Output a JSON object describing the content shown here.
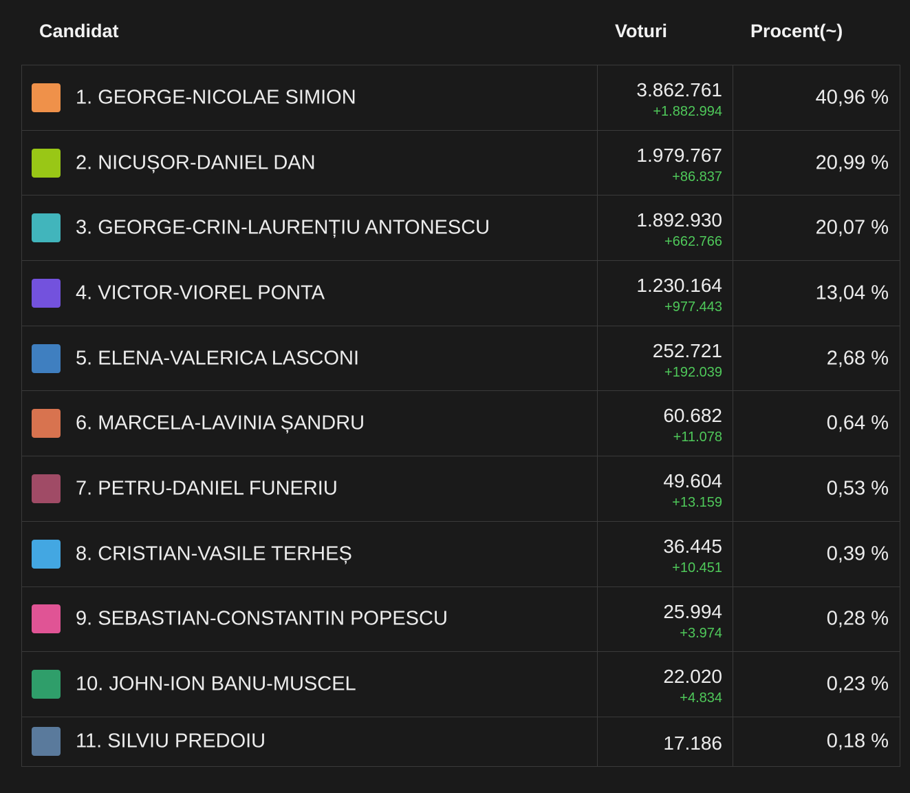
{
  "header": {
    "candidate": "Candidat",
    "votes": "Voturi",
    "percent": "Procent(~)"
  },
  "rows": [
    {
      "name": "1. GEORGE-NICOLAE SIMION",
      "votes": "3.862.761",
      "delta": "+1.882.994",
      "percent": "40,96 %",
      "color": "#ef914a"
    },
    {
      "name": "2. NICUȘOR-DANIEL DAN",
      "votes": "1.979.767",
      "delta": "+86.837",
      "percent": "20,99 %",
      "color": "#99c716"
    },
    {
      "name": "3. GEORGE-CRIN-LAURENȚIU ANTONESCU",
      "votes": "1.892.930",
      "delta": "+662.766",
      "percent": "20,07 %",
      "color": "#41b5bc"
    },
    {
      "name": "4. VICTOR-VIOREL PONTA",
      "votes": "1.230.164",
      "delta": "+977.443",
      "percent": "13,04 %",
      "color": "#7352dd"
    },
    {
      "name": "5. ELENA-VALERICA LASCONI",
      "votes": "252.721",
      "delta": "+192.039",
      "percent": "2,68 %",
      "color": "#3f7fc0"
    },
    {
      "name": "6. MARCELA-LAVINIA ȘANDRU",
      "votes": "60.682",
      "delta": "+11.078",
      "percent": "0,64 %",
      "color": "#d8734f"
    },
    {
      "name": "7. PETRU-DANIEL FUNERIU",
      "votes": "49.604",
      "delta": "+13.159",
      "percent": "0,53 %",
      "color": "#a04b66"
    },
    {
      "name": "8. CRISTIAN-VASILE TERHEȘ",
      "votes": "36.445",
      "delta": "+10.451",
      "percent": "0,39 %",
      "color": "#43a7e2"
    },
    {
      "name": "9. SEBASTIAN-CONSTANTIN POPESCU",
      "votes": "25.994",
      "delta": "+3.974",
      "percent": "0,28 %",
      "color": "#e05495"
    },
    {
      "name": "10. JOHN-ION BANU-MUSCEL",
      "votes": "22.020",
      "delta": "+4.834",
      "percent": "0,23 %",
      "color": "#2f9e6a"
    },
    {
      "name": "11. SILVIU PREDOIU",
      "votes": "17.186",
      "delta": "",
      "percent": "0,18 %",
      "color": "#5a7a9c"
    }
  ]
}
